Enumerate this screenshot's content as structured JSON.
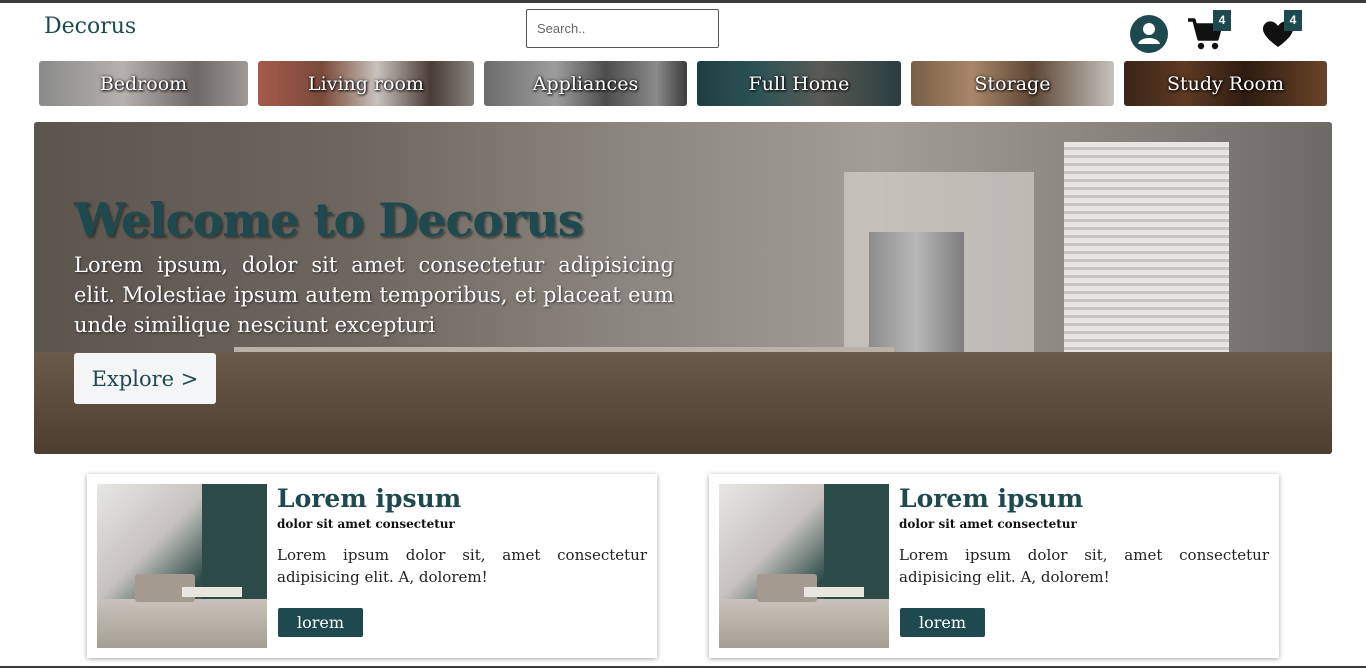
{
  "header": {
    "brand": "Decorus",
    "search_placeholder": "Search..",
    "cart_count": "4",
    "wishlist_count": "4",
    "icons": [
      "user-icon",
      "cart-icon",
      "heart-icon"
    ]
  },
  "categories": [
    {
      "label": "Bedroom"
    },
    {
      "label": "Living room"
    },
    {
      "label": "Appliances"
    },
    {
      "label": "Full Home"
    },
    {
      "label": "Storage"
    },
    {
      "label": "Study Room"
    }
  ],
  "hero": {
    "title": "Welcome to Decorus",
    "text": "Lorem ipsum, dolor sit amet consectetur adipisicing elit. Molestiae ipsum autem temporibus, et placeat eum unde similique nesciunt excepturi",
    "button": "Explore >"
  },
  "cards": [
    {
      "title": "Lorem ipsum",
      "subtitle": "dolor sit amet consectetur",
      "text": "Lorem ipsum dolor sit, amet consectetur adipisicing elit. A, dolorem!",
      "button": "lorem"
    },
    {
      "title": "Lorem ipsum",
      "subtitle": "dolor sit amet consectetur",
      "text": "Lorem ipsum dolor sit, amet consectetur adipisicing elit. A, dolorem!",
      "button": "lorem"
    }
  ],
  "colors": {
    "accent": "#1e4a4f",
    "background": "#ffffff"
  }
}
